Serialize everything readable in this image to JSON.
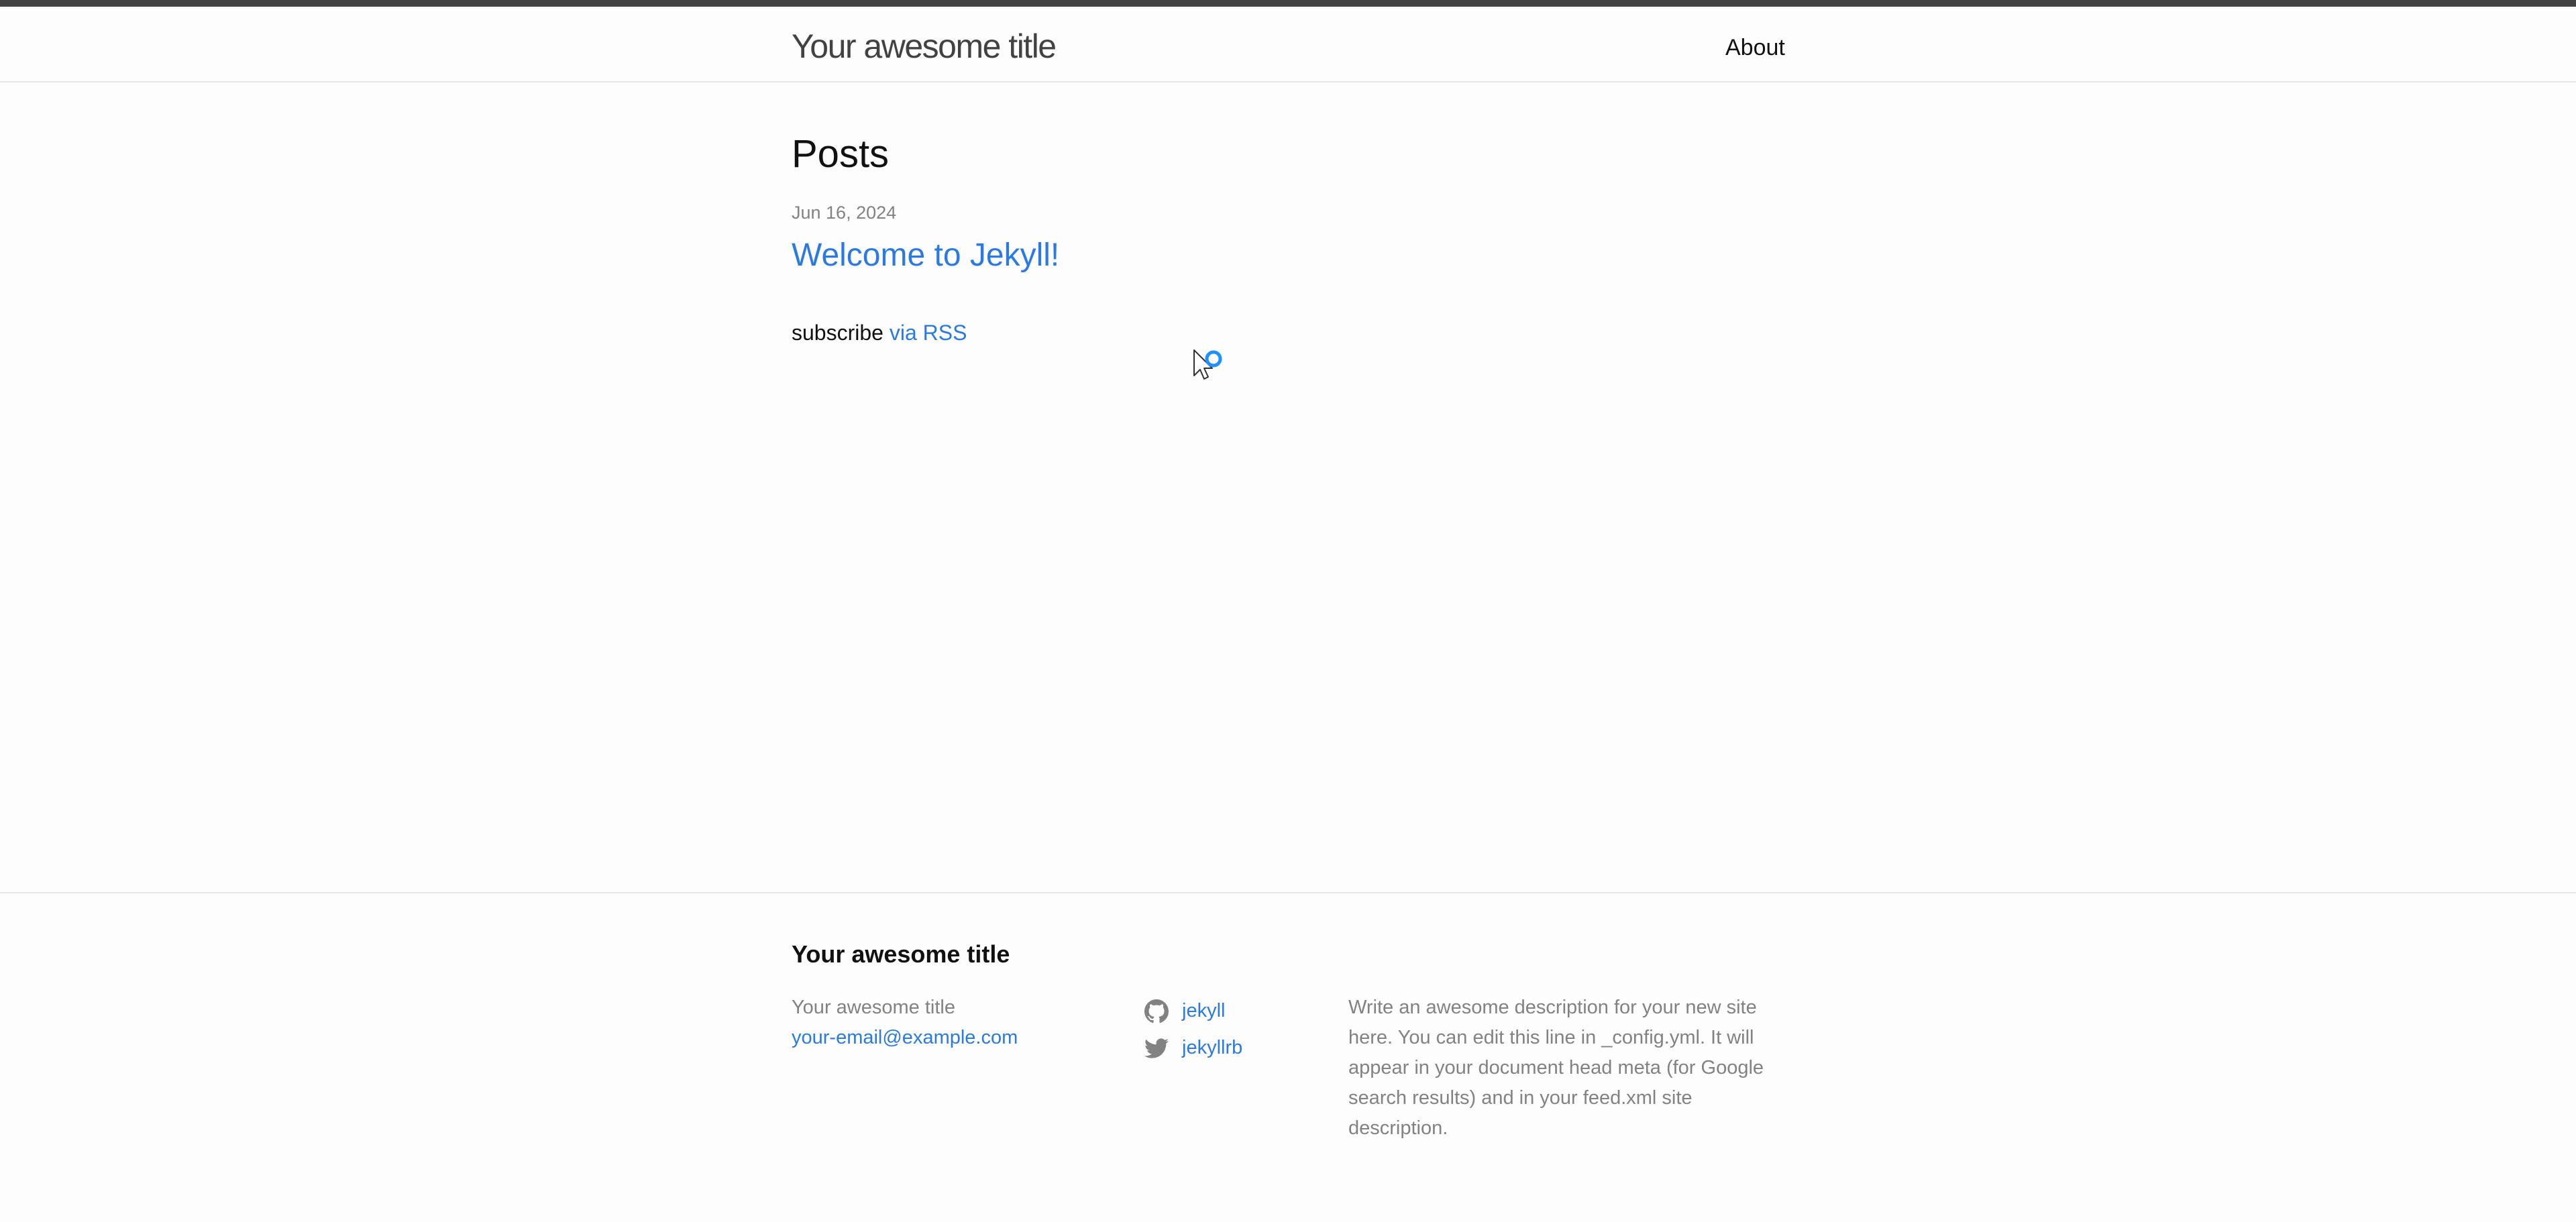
{
  "header": {
    "site_title": "Your awesome title",
    "nav": {
      "about": "About"
    }
  },
  "main": {
    "heading": "Posts",
    "posts": [
      {
        "date": "Jun 16, 2024",
        "title": "Welcome to Jekyll!"
      }
    ],
    "subscribe_text": "subscribe",
    "rss_link": "via RSS"
  },
  "footer": {
    "heading": "Your awesome title",
    "contact_name": "Your awesome title",
    "email": "your-email@example.com",
    "social": {
      "github": {
        "icon": "github-icon",
        "username": "jekyll"
      },
      "twitter": {
        "icon": "twitter-icon",
        "username": "jekyllrb"
      }
    },
    "description": "Write an awesome description for your new site here. You can edit this line in _config.yml. It will appear in your document head meta (for Google search results) and in your feed.xml site description."
  },
  "colors": {
    "link": "#2a7ae2",
    "text": "#111111",
    "muted": "#828282",
    "top_bar": "#424242",
    "background": "#fdfdfd"
  }
}
